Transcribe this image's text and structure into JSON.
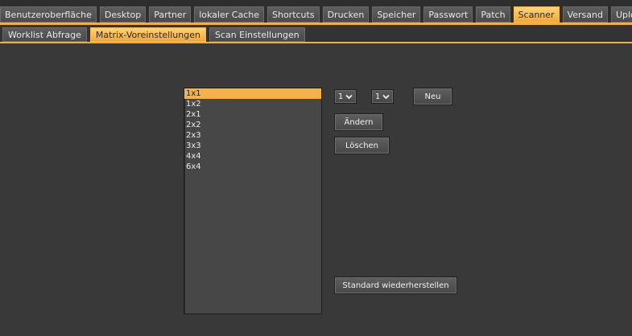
{
  "top_tabs": [
    {
      "label": "Benutzeroberfläche",
      "active": false
    },
    {
      "label": "Desktop",
      "active": false
    },
    {
      "label": "Partner",
      "active": false
    },
    {
      "label": "lokaler Cache",
      "active": false
    },
    {
      "label": "Shortcuts",
      "active": false
    },
    {
      "label": "Drucken",
      "active": false
    },
    {
      "label": "Speicher",
      "active": false
    },
    {
      "label": "Passwort",
      "active": false
    },
    {
      "label": "Patch",
      "active": false
    },
    {
      "label": "Scanner",
      "active": true
    },
    {
      "label": "Versand",
      "active": false
    },
    {
      "label": "Upload",
      "active": false
    }
  ],
  "sub_tabs": [
    {
      "label": "Worklist Abfrage",
      "active": false
    },
    {
      "label": "Matrix-Voreinstellungen",
      "active": true
    },
    {
      "label": "Scan Einstellungen",
      "active": false
    }
  ],
  "matrix_list": {
    "items": [
      "1x1",
      "1x2",
      "2x1",
      "2x2",
      "2x3",
      "3x3",
      "4x4",
      "6x4"
    ],
    "selected": "1x1"
  },
  "controls": {
    "rows_select": {
      "value": "1",
      "icon": "chevron-down-icon"
    },
    "cols_select": {
      "value": "1",
      "icon": "chevron-down-icon"
    },
    "new_label": "Neu",
    "change_label": "Ändern",
    "delete_label": "Löschen",
    "restore_label": "Standard wiederherstellen"
  },
  "colors": {
    "accent": "#f2ae45",
    "background": "#393939"
  }
}
